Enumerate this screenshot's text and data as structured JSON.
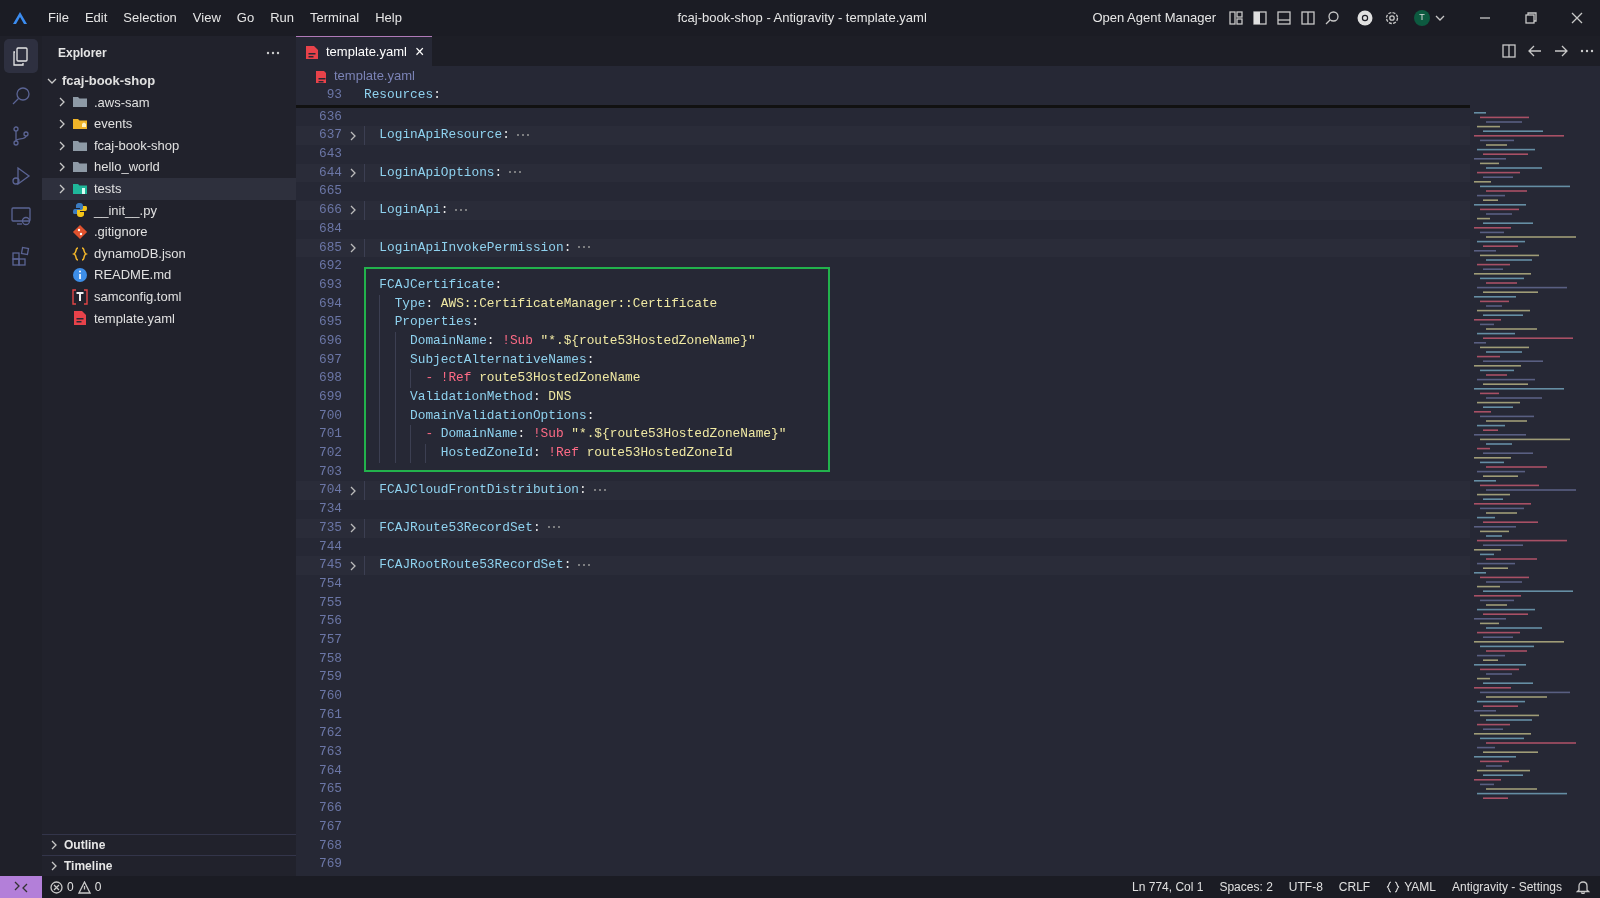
{
  "window": {
    "title": "fcaj-book-shop - Antigravity - template.yaml",
    "menu": [
      "File",
      "Edit",
      "Selection",
      "View",
      "Go",
      "Run",
      "Terminal",
      "Help"
    ],
    "agent_button": "Open Agent Manager",
    "avatar": "T"
  },
  "activity_bar": [
    {
      "kind": "explorer",
      "selected": true
    },
    {
      "kind": "search",
      "selected": false
    },
    {
      "kind": "source-control",
      "selected": false
    },
    {
      "kind": "run-debug",
      "selected": false
    },
    {
      "kind": "remote",
      "selected": false
    },
    {
      "kind": "extensions",
      "selected": false
    }
  ],
  "sidebar": {
    "title": "Explorer",
    "root": {
      "label": "fcaj-book-shop",
      "expanded": true,
      "children": [
        {
          "label": ".aws-sam",
          "kind": "folder",
          "expanded": false,
          "selected": false
        },
        {
          "label": "events",
          "kind": "folder-events",
          "expanded": false,
          "selected": false
        },
        {
          "label": "fcaj-book-shop",
          "kind": "folder",
          "expanded": false,
          "selected": false
        },
        {
          "label": "hello_world",
          "kind": "folder",
          "expanded": false,
          "selected": false
        },
        {
          "label": "tests",
          "kind": "folder-tests",
          "expanded": false,
          "selected": true
        },
        {
          "label": "__init__.py",
          "kind": "python",
          "selected": false
        },
        {
          "label": ".gitignore",
          "kind": "git",
          "selected": false
        },
        {
          "label": "dynamoDB.json",
          "kind": "json",
          "selected": false
        },
        {
          "label": "README.md",
          "kind": "info",
          "selected": false
        },
        {
          "label": "samconfig.toml",
          "kind": "toml",
          "selected": false
        },
        {
          "label": "template.yaml",
          "kind": "yaml",
          "selected": false
        }
      ]
    },
    "panels": [
      {
        "label": "Outline",
        "expanded": false
      },
      {
        "label": "Timeline",
        "expanded": false
      }
    ]
  },
  "editor": {
    "tabs": [
      {
        "label": "template.yaml",
        "close": "×",
        "selected": true
      }
    ],
    "breadcrumb": "template.yaml",
    "sticky": {
      "number": "93",
      "tokens": [
        {
          "kind": "key",
          "text": "Resources"
        },
        {
          "kind": "punct",
          "text": ":"
        }
      ]
    },
    "lines": [
      {
        "kind": "line",
        "number": "636",
        "folded": false
      },
      {
        "kind": "line",
        "number": "637",
        "folded": true,
        "tokens": [
          {
            "kind": "key",
            "text": "  LoginApiResource"
          },
          {
            "kind": "punct",
            "text": ":"
          }
        ]
      },
      {
        "kind": "line",
        "number": "643",
        "folded": false
      },
      {
        "kind": "line",
        "number": "644",
        "folded": true,
        "tokens": [
          {
            "kind": "key",
            "text": "  LoginApiOptions"
          },
          {
            "kind": "punct",
            "text": ":"
          }
        ]
      },
      {
        "kind": "line",
        "number": "665",
        "folded": false
      },
      {
        "kind": "line",
        "number": "666",
        "folded": true,
        "tokens": [
          {
            "kind": "key",
            "text": "  LoginApi"
          },
          {
            "kind": "punct",
            "text": ":"
          }
        ]
      },
      {
        "kind": "line",
        "number": "684",
        "folded": false
      },
      {
        "kind": "line",
        "number": "685",
        "folded": true,
        "tokens": [
          {
            "kind": "key",
            "text": "  LoginApiInvokePermission"
          },
          {
            "kind": "punct",
            "text": ":"
          }
        ]
      },
      {
        "kind": "line",
        "number": "692",
        "folded": false
      },
      {
        "kind": "highlight-box",
        "lines": [
          {
            "kind": "line",
            "number": "693",
            "folded": false,
            "tokens": [
              {
                "kind": "key",
                "text": "  FCAJCertificate"
              },
              {
                "kind": "punct",
                "text": ":"
              }
            ]
          },
          {
            "kind": "line",
            "number": "694",
            "folded": false,
            "tokens": [
              {
                "kind": "key",
                "text": "    Type"
              },
              {
                "kind": "punct",
                "text": ":"
              },
              {
                "kind": "str",
                "text": "AWS::CertificateManager::Certificate"
              }
            ]
          },
          {
            "kind": "line",
            "number": "695",
            "folded": false,
            "tokens": [
              {
                "kind": "key",
                "text": "    Properties"
              },
              {
                "kind": "punct",
                "text": ":"
              }
            ]
          },
          {
            "kind": "line",
            "number": "696",
            "folded": false,
            "tokens": [
              {
                "kind": "key",
                "text": "      DomainName"
              },
              {
                "kind": "punct",
                "text": ":"
              },
              {
                "kind": "tag",
                "text": "!Sub"
              },
              {
                "kind": "str",
                "text": "\"*.${route53HostedZoneName}\""
              }
            ]
          },
          {
            "kind": "line",
            "number": "697",
            "folded": false,
            "tokens": [
              {
                "kind": "key",
                "text": "      SubjectAlternativeNames"
              },
              {
                "kind": "punct",
                "text": ":"
              }
            ]
          },
          {
            "kind": "line",
            "number": "698",
            "folded": false,
            "tokens": [
              {
                "kind": "dash",
                "text": "        -"
              },
              {
                "kind": "tag",
                "text": "!Ref"
              },
              {
                "kind": "str",
                "text": "route53HostedZoneName"
              }
            ]
          },
          {
            "kind": "line",
            "number": "699",
            "folded": false,
            "tokens": [
              {
                "kind": "key",
                "text": "      ValidationMethod"
              },
              {
                "kind": "punct",
                "text": ":"
              },
              {
                "kind": "str",
                "text": "DNS"
              }
            ]
          },
          {
            "kind": "line",
            "number": "700",
            "folded": false,
            "tokens": [
              {
                "kind": "key",
                "text": "      DomainValidationOptions"
              },
              {
                "kind": "punct",
                "text": ":"
              }
            ]
          },
          {
            "kind": "line",
            "number": "701",
            "folded": false,
            "tokens": [
              {
                "kind": "dash",
                "text": "        -"
              },
              {
                "kind": "key",
                "text": "DomainName"
              },
              {
                "kind": "punct",
                "text": ":"
              },
              {
                "kind": "tag",
                "text": "!Sub"
              },
              {
                "kind": "str",
                "text": "\"*.${route53HostedZoneName}\""
              }
            ]
          },
          {
            "kind": "line",
            "number": "702",
            "folded": false,
            "tokens": [
              {
                "kind": "key",
                "text": "          HostedZoneId"
              },
              {
                "kind": "punct",
                "text": ":"
              },
              {
                "kind": "tag",
                "text": "!Ref"
              },
              {
                "kind": "str",
                "text": "route53HostedZoneId"
              }
            ]
          }
        ]
      },
      {
        "kind": "line",
        "number": "703",
        "folded": false
      },
      {
        "kind": "line",
        "number": "704",
        "folded": true,
        "tokens": [
          {
            "kind": "key",
            "text": "  FCAJCloudFrontDistribution"
          },
          {
            "kind": "punct",
            "text": ":"
          }
        ]
      },
      {
        "kind": "line",
        "number": "734",
        "folded": false
      },
      {
        "kind": "line",
        "number": "735",
        "folded": true,
        "tokens": [
          {
            "kind": "key",
            "text": "  FCAJRoute53RecordSet"
          },
          {
            "kind": "punct",
            "text": ":"
          }
        ]
      },
      {
        "kind": "line",
        "number": "744",
        "folded": false
      },
      {
        "kind": "line",
        "number": "745",
        "folded": true,
        "tokens": [
          {
            "kind": "key",
            "text": "  FCAJRootRoute53RecordSet"
          },
          {
            "kind": "punct",
            "text": ":"
          }
        ]
      },
      {
        "kind": "line",
        "number": "754",
        "folded": false
      },
      {
        "kind": "line",
        "number": "755",
        "folded": false
      },
      {
        "kind": "line",
        "number": "756",
        "folded": false
      },
      {
        "kind": "line",
        "number": "757",
        "folded": false
      },
      {
        "kind": "line",
        "number": "758",
        "folded": false
      },
      {
        "kind": "line",
        "number": "759",
        "folded": false
      },
      {
        "kind": "line",
        "number": "760",
        "folded": false
      },
      {
        "kind": "line",
        "number": "761",
        "folded": false
      },
      {
        "kind": "line",
        "number": "762",
        "folded": false
      },
      {
        "kind": "line",
        "number": "763",
        "folded": false
      },
      {
        "kind": "line",
        "number": "764",
        "folded": false
      },
      {
        "kind": "line",
        "number": "765",
        "folded": false
      },
      {
        "kind": "line",
        "number": "766",
        "folded": false
      },
      {
        "kind": "line",
        "number": "767",
        "folded": false
      },
      {
        "kind": "line",
        "number": "768",
        "folded": false
      },
      {
        "kind": "line",
        "number": "769",
        "folded": false
      }
    ]
  },
  "status_bar": {
    "errors": "0",
    "warnings": "0",
    "items": [
      "Ln 774, Col 1",
      "Spaces: 2",
      "UTF-8",
      "CRLF",
      "YAML",
      "Antigravity - Settings"
    ]
  }
}
